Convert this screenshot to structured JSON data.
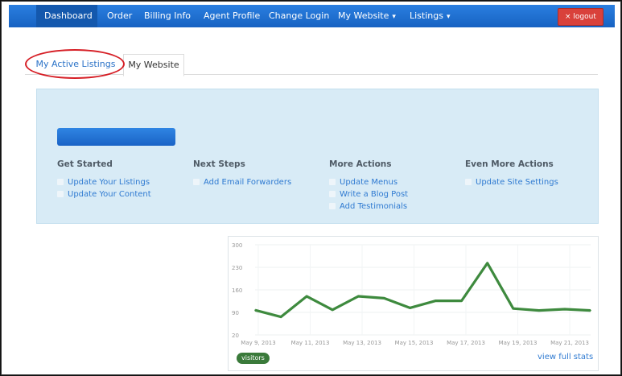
{
  "nav": {
    "items": [
      {
        "label": "Dashboard",
        "active": true
      },
      {
        "label": "Order"
      },
      {
        "label": "Billing Info"
      },
      {
        "label": "Agent Profile"
      },
      {
        "label": "Change Login"
      },
      {
        "label": "My Website",
        "dropdown": true
      },
      {
        "label": "Listings",
        "dropdown": true
      }
    ],
    "logout_label": "× logout",
    "colors": {
      "bar": "#1e6fd1",
      "active": "#1458ad",
      "logout": "#d9413b"
    }
  },
  "tabs": [
    {
      "label": "My Active Listings",
      "highlighted_with_red_ellipse": true
    },
    {
      "label": "My Website",
      "selected": true
    }
  ],
  "panel": {
    "columns": [
      {
        "title": "Get Started",
        "links": [
          {
            "label": "Update Your Listings",
            "icon": "home-icon"
          },
          {
            "label": "Update Your Content",
            "icon": "document-icon"
          }
        ]
      },
      {
        "title": "Next Steps",
        "links": [
          {
            "label": "Add Email Forwarders",
            "icon": "envelope-icon"
          }
        ]
      },
      {
        "title": "More Actions",
        "links": [
          {
            "label": "Update Menus",
            "icon": "list-icon"
          },
          {
            "label": "Write a Blog Post",
            "icon": "pencil-icon"
          },
          {
            "label": "Add Testimonials",
            "icon": "comment-icon"
          }
        ]
      },
      {
        "title": "Even More Actions",
        "links": [
          {
            "label": "Update Site Settings",
            "icon": "wrench-icon"
          }
        ]
      }
    ],
    "colors": {
      "background": "#d8ebf6",
      "link": "#2f7ad1"
    }
  },
  "chart_data": {
    "type": "line",
    "y_ticks": [
      "300",
      "230",
      "160",
      "90",
      "20"
    ],
    "ylim": [
      20,
      300
    ],
    "x_tick_labels": [
      "May 9, 2013",
      "May 11, 2013",
      "May 13, 2013",
      "May 15, 2013",
      "May 17, 2013",
      "May 19, 2013",
      "May 21, 2013"
    ],
    "series": [
      {
        "name": "visitors",
        "color": "#3e8a3e",
        "values": [
          97,
          76,
          140,
          98,
          140,
          134,
          104,
          126,
          126,
          243,
          102,
          96,
          100,
          96
        ]
      }
    ],
    "grid": true
  },
  "view_stats_label": "view full stats"
}
